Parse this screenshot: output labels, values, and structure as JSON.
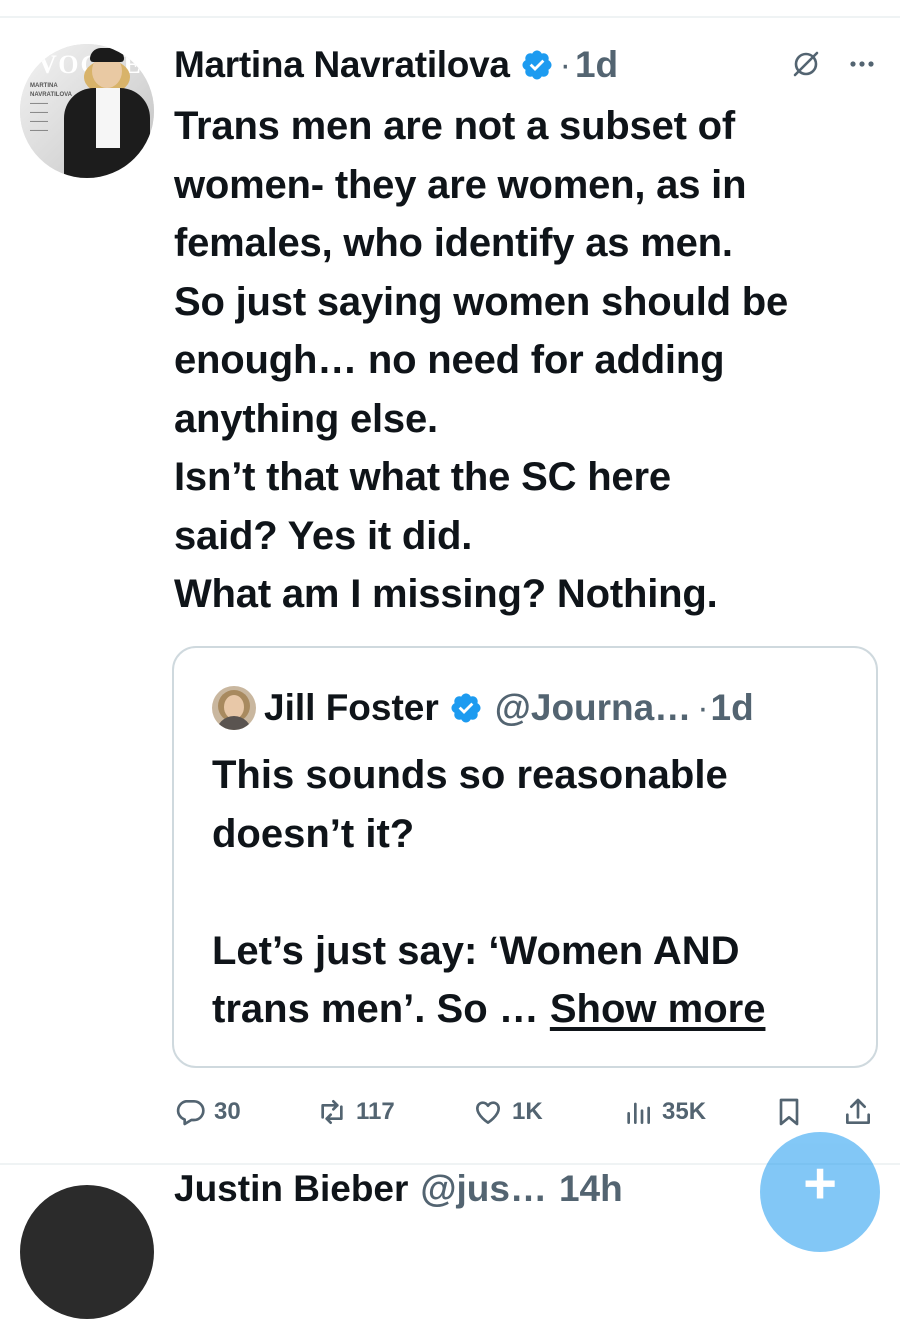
{
  "post": {
    "author_name": "Martina Navratilova",
    "time": "1d",
    "separator": "·",
    "avatar_brand_text": "VOGUE",
    "body_lines": [
      "Trans men are not a subset of",
      "women- they are women, as in",
      "females, who identify as men.",
      "So just saying women should be",
      "enough… no need for adding",
      "anything else.",
      "Isn’t  that what the SC here",
      "said?  Yes it did.",
      "What am I missing? Nothing."
    ]
  },
  "quote": {
    "author_name": "Jill Foster",
    "handle": "@Journa…",
    "separator": "·",
    "time": "1d",
    "lines": [
      "This sounds so reasonable",
      "doesn’t it?",
      "",
      "Let’s just say: ‘Women AND"
    ],
    "last_line_prefix": "trans men’. So … ",
    "show_more": "Show more"
  },
  "actions": {
    "replies": "30",
    "reposts": "117",
    "likes": "1K",
    "views": "35K"
  },
  "next_post": {
    "author_name": "Justin Bieber",
    "handle": "@jus…",
    "time": "14h"
  },
  "fab": {
    "label": "+"
  },
  "colors": {
    "verified_blue": "#1d9bf0",
    "muted_text": "#536471",
    "text": "#0f1419",
    "border": "#cfd9de"
  }
}
